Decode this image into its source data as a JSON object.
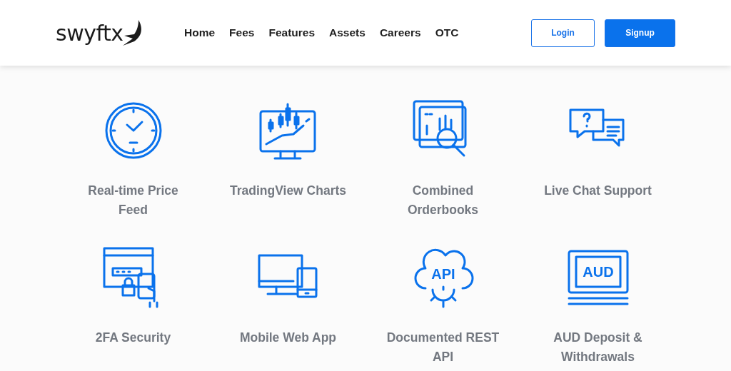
{
  "logo": {
    "text": "swyftx"
  },
  "nav": [
    {
      "label": "Home"
    },
    {
      "label": "Fees"
    },
    {
      "label": "Features"
    },
    {
      "label": "Assets"
    },
    {
      "label": "Careers"
    },
    {
      "label": "OTC"
    }
  ],
  "actions": [
    {
      "label": "Login",
      "kind": "outline"
    },
    {
      "label": "Signup",
      "kind": "solid"
    }
  ],
  "features": [
    {
      "title": "Real-time Price Feed"
    },
    {
      "title": "TradingView Charts"
    },
    {
      "title": "Combined Orderbooks"
    },
    {
      "title": "Live Chat Support"
    },
    {
      "title": "2FA Security"
    },
    {
      "title": "Mobile Web App"
    },
    {
      "title": "Documented REST API",
      "icon_text": "API"
    },
    {
      "title": "AUD Deposit & Withdrawals",
      "icon_text": "AUD"
    }
  ]
}
